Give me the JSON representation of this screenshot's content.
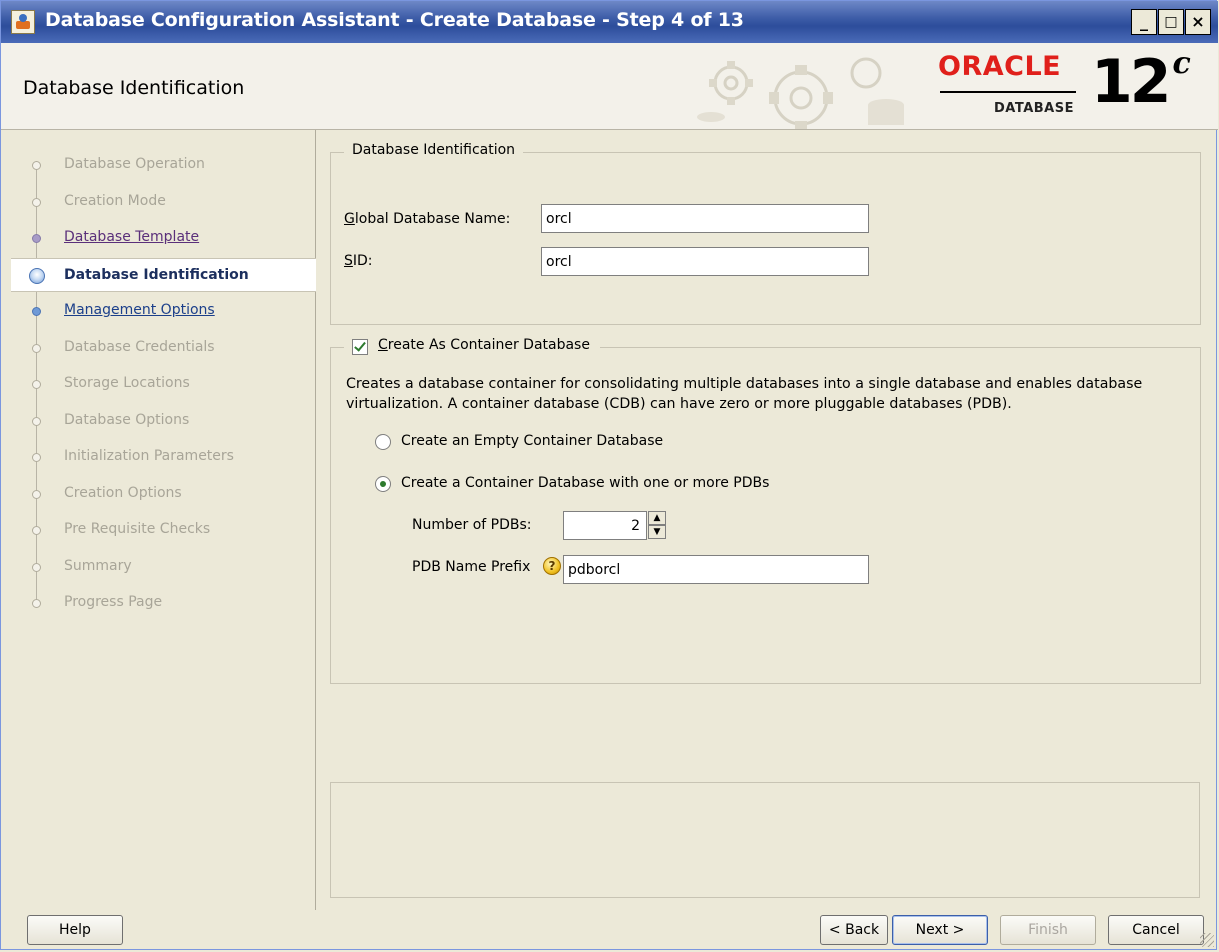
{
  "window": {
    "title": "Database Configuration Assistant - Create Database - Step 4 of 13",
    "controls": [
      "_",
      "□",
      "×"
    ]
  },
  "header": {
    "title": "Database Identification",
    "brand": "ORACLE",
    "product": "DATABASE",
    "version": "12",
    "version_suffix": "c"
  },
  "nav": {
    "items": [
      {
        "label": "Database Operation",
        "state": "disabled"
      },
      {
        "label": "Creation Mode",
        "state": "disabled"
      },
      {
        "label": "Database Template",
        "state": "visited"
      },
      {
        "label": "Database Identification",
        "state": "active"
      },
      {
        "label": "Management Options",
        "state": "next"
      },
      {
        "label": "Database Credentials",
        "state": "disabled"
      },
      {
        "label": "Storage Locations",
        "state": "disabled"
      },
      {
        "label": "Database Options",
        "state": "disabled"
      },
      {
        "label": "Initialization Parameters",
        "state": "disabled"
      },
      {
        "label": "Creation Options",
        "state": "disabled"
      },
      {
        "label": "Pre Requisite Checks",
        "state": "disabled"
      },
      {
        "label": "Summary",
        "state": "disabled"
      },
      {
        "label": "Progress Page",
        "state": "disabled"
      }
    ]
  },
  "identification": {
    "group_title": "Database Identification",
    "global_name_label": "Global Database Name:",
    "global_name_value": "orcl",
    "sid_label": "SID:",
    "sid_value": "orcl"
  },
  "container": {
    "checkbox_label": "Create As Container Database",
    "checked": true,
    "description": "Creates a database container for consolidating multiple databases into a single database and enables database virtualization. A container database (CDB) can have zero or more pluggable databases (PDB).",
    "option_empty": "Create an Empty Container Database",
    "option_with_pdbs": "Create a Container Database with one or more PDBs",
    "selected_option": "with_pdbs",
    "num_pdbs_label": "Number of PDBs:",
    "num_pdbs_value": "2",
    "pdb_prefix_label": "PDB Name Prefix",
    "pdb_prefix_value": "pdborcl"
  },
  "buttons": {
    "help": "Help",
    "back": "< Back",
    "next": "Next >",
    "finish": "Finish",
    "cancel": "Cancel"
  },
  "colors": {
    "titlebar": "#2d4d9b",
    "oracle_red": "#e0201b",
    "check_green": "#2d7a2d"
  }
}
